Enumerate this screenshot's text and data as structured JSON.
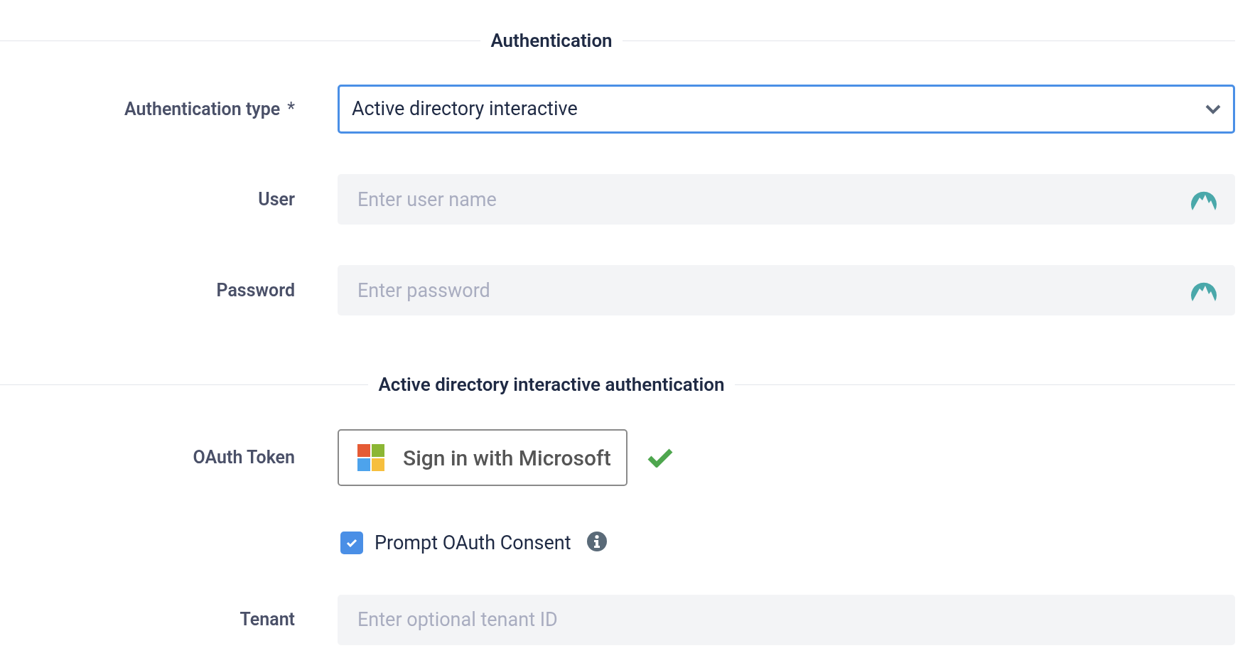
{
  "sections": [
    {
      "title": "Authentication",
      "fields": [
        {
          "kind": "select",
          "label": "Authentication type",
          "required_mark": "*",
          "value": "Active directory interactive"
        },
        {
          "kind": "credential",
          "label": "User",
          "placeholder": "Enter user name"
        },
        {
          "kind": "credential",
          "label": "Password",
          "placeholder": "Enter password"
        }
      ]
    },
    {
      "title": "Active directory interactive authentication",
      "fields": [
        {
          "kind": "oauth",
          "label": "OAuth Token",
          "button_label": "Sign in with Microsoft",
          "signed_in": true
        },
        {
          "kind": "checkbox",
          "label": "Prompt OAuth Consent",
          "checked": true
        },
        {
          "kind": "text",
          "label": "Tenant",
          "placeholder": "Enter optional tenant ID"
        }
      ]
    }
  ]
}
